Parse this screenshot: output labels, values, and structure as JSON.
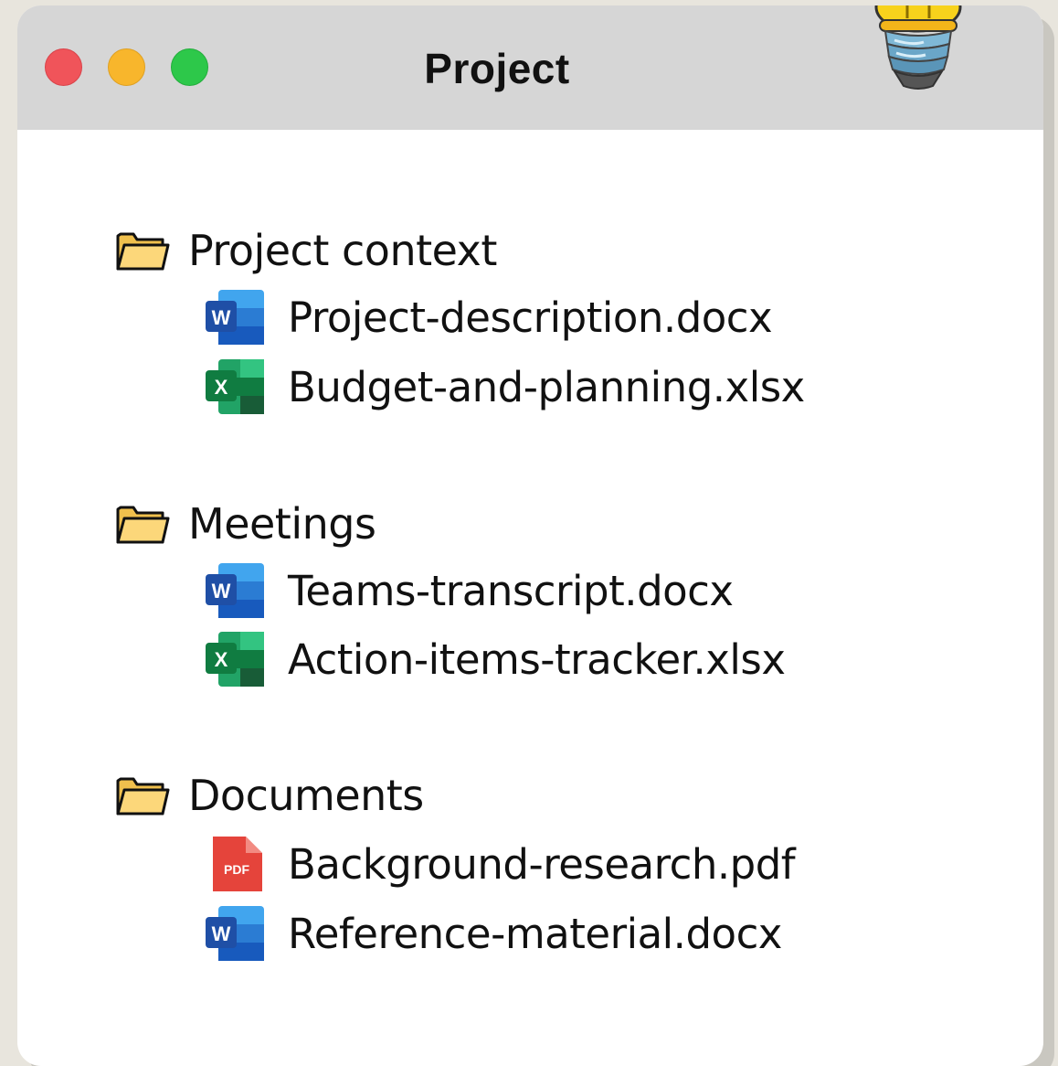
{
  "window": {
    "title": "Project"
  },
  "folders": [
    {
      "label": "Project context",
      "files": [
        {
          "name": "Project-description.docx",
          "type": "word"
        },
        {
          "name": "Budget-and-planning.xlsx",
          "type": "excel"
        }
      ]
    },
    {
      "label": "Meetings",
      "files": [
        {
          "name": "Teams-transcript.docx",
          "type": "word"
        },
        {
          "name": "Action-items-tracker.xlsx",
          "type": "excel"
        }
      ]
    },
    {
      "label": "Documents",
      "files": [
        {
          "name": "Background-research.pdf",
          "type": "pdf"
        },
        {
          "name": "Reference-material.docx",
          "type": "word"
        }
      ]
    }
  ],
  "icons": {
    "word_letter": "W",
    "excel_letter": "X",
    "pdf_letter": "PDF"
  },
  "colors": {
    "titlebar": "#d6d6d6",
    "close": "#f0545a",
    "minimize": "#f8b62c",
    "maximize": "#2dc84a",
    "folder_fill": "#fcd77a",
    "word_blue": "#185abd",
    "excel_green": "#107c41",
    "pdf_red": "#e5443b"
  }
}
